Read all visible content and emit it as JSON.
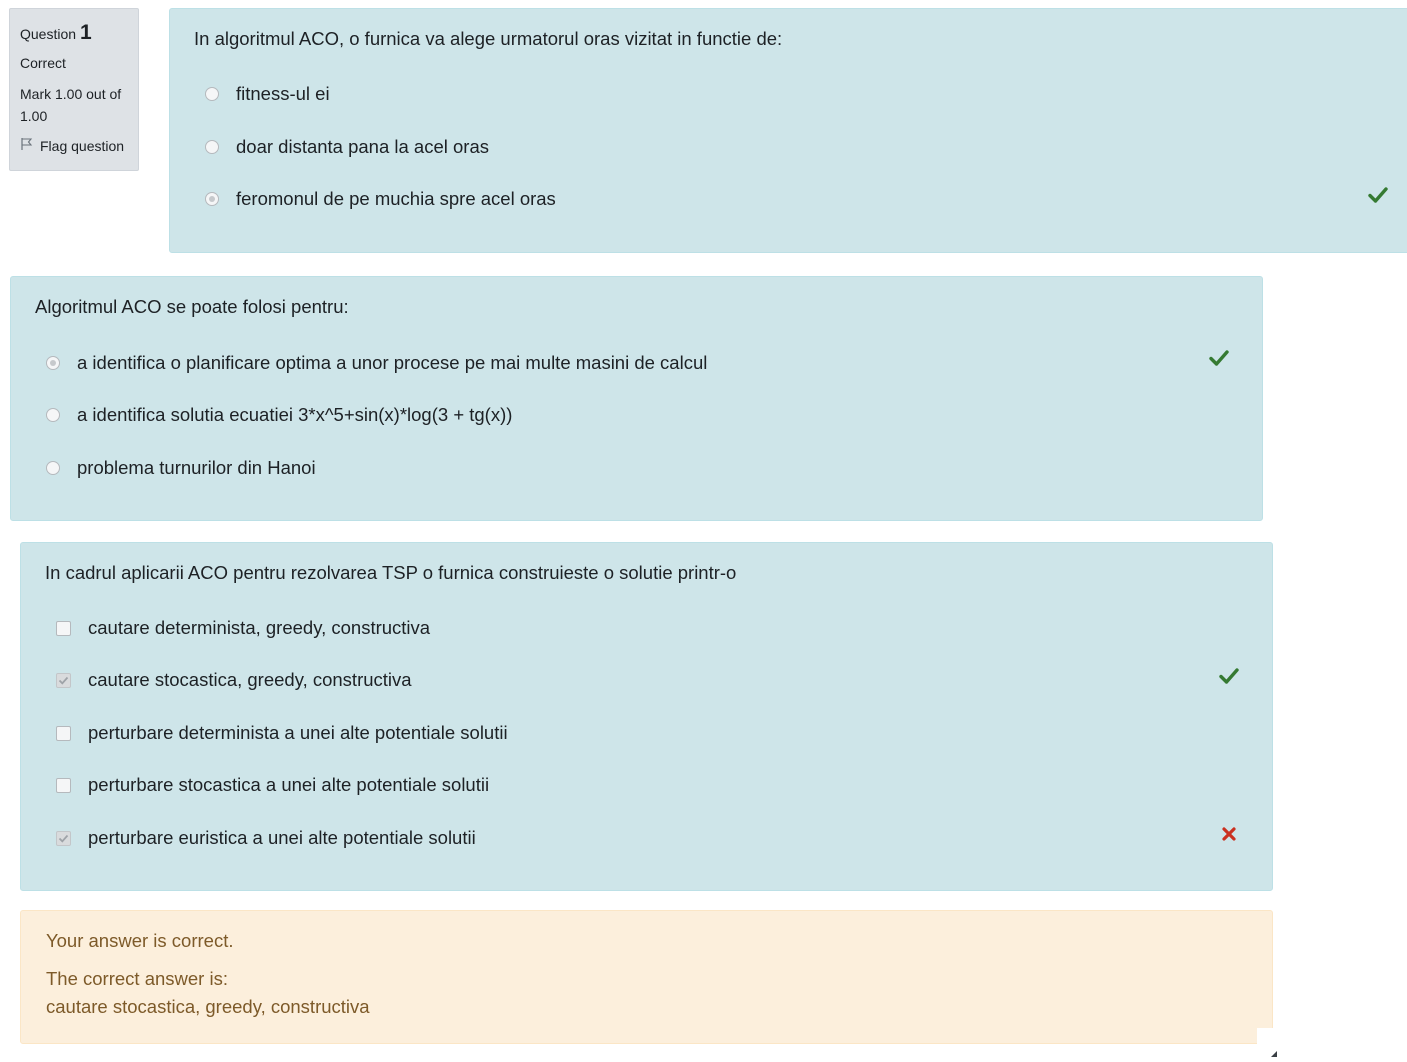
{
  "info": {
    "question_label": "Question",
    "question_number": "1",
    "state": "Correct",
    "grade": "Mark 1.00 out of 1.00",
    "flag_label": "Flag question"
  },
  "q1": {
    "text": "In algoritmul ACO, o furnica va alege urmatorul oras vizitat in functie de:",
    "options": [
      {
        "label": "fitness-ul ei",
        "selected": false
      },
      {
        "label": "doar distanta pana la acel oras",
        "selected": false
      },
      {
        "label": "feromonul de pe muchia spre acel oras",
        "selected": true,
        "mark": "correct"
      }
    ]
  },
  "q2": {
    "text": "Algoritmul ACO se poate folosi pentru:",
    "options": [
      {
        "label": "a identifica o planificare optima a unor procese pe mai multe masini de calcul",
        "selected": true,
        "mark": "correct"
      },
      {
        "label": "a identifica solutia ecuatiei 3*x^5+sin(x)*log(3 + tg(x))",
        "selected": false
      },
      {
        "label": "problema turnurilor din Hanoi",
        "selected": false
      }
    ]
  },
  "q3": {
    "text": "In cadrul aplicarii ACO pentru rezolvarea TSP o furnica construieste o solutie printr-o",
    "options": [
      {
        "label": "cautare determinista, greedy, constructiva",
        "selected": false
      },
      {
        "label": "cautare stocastica, greedy, constructiva",
        "selected": true,
        "mark": "correct"
      },
      {
        "label": "perturbare determinista a unei alte potentiale solutii",
        "selected": false
      },
      {
        "label": "perturbare stocastica a unei alte potentiale solutii",
        "selected": false
      },
      {
        "label": "perturbare euristica a unei alte potentiale solutii",
        "selected": true,
        "mark": "incorrect"
      }
    ]
  },
  "feedback": {
    "result": "Your answer is correct.",
    "correct_label": "The correct answer is:",
    "correct_answer": "cautare stocastica, greedy, constructiva"
  },
  "colors": {
    "question_bg": "#cee5e9",
    "feedback_bg": "#fcefdc",
    "feedback_text": "#7d5a29",
    "correct_mark": "#357a32",
    "incorrect_mark": "#ca3120"
  }
}
